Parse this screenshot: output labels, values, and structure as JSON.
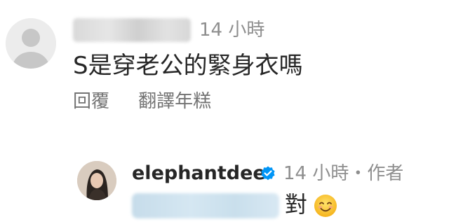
{
  "comment": {
    "time": "14 小時",
    "text": "S是穿老公的緊身衣嗎",
    "reply_label": "回覆",
    "translate_label": "翻譯年糕"
  },
  "reply": {
    "username": "elephantdee",
    "meta": "14 小時・作者",
    "text": "對",
    "emoji": "smiling-face-icon"
  },
  "colors": {
    "text_primary": "#262626",
    "text_secondary": "#8e8e8e",
    "action_text": "#737373",
    "verified_blue": "#0095f6"
  }
}
